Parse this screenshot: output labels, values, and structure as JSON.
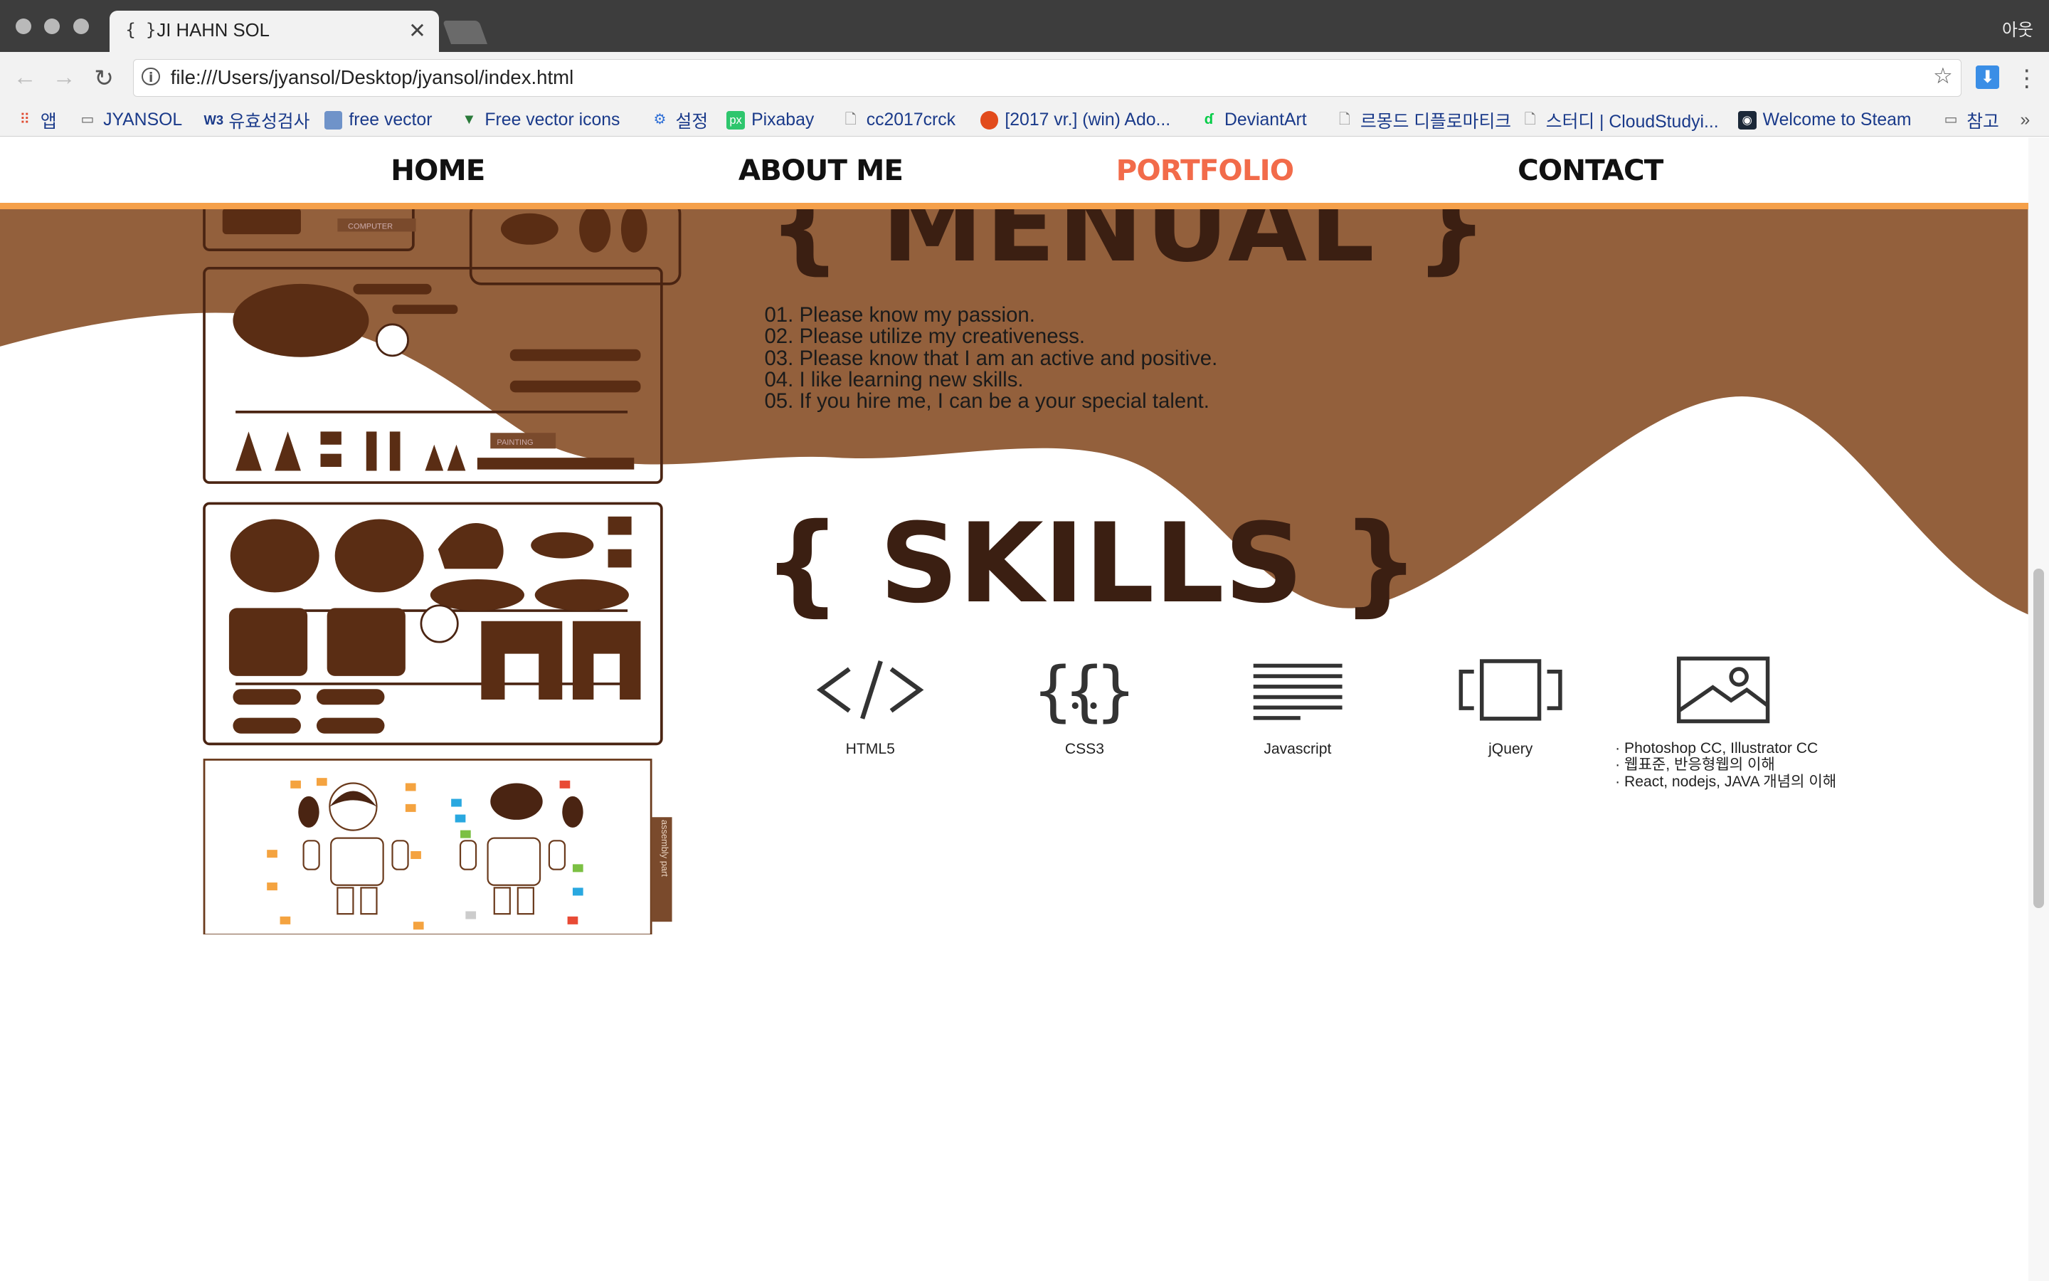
{
  "browser": {
    "tab_title": "JI HAHN SOL",
    "tab_icon_text": "{ }",
    "profile_label": "아웃",
    "url": "file:///Users/jyansol/Desktop/jyansol/index.html"
  },
  "bookmarks": [
    {
      "label": "앱",
      "icon": "apps-grid-icon"
    },
    {
      "label": "JYANSOL",
      "icon": "folder-icon"
    },
    {
      "label": "유효성검사",
      "icon": "w3c-icon"
    },
    {
      "label": "free vector",
      "icon": "image-icon"
    },
    {
      "label": "Free vector icons",
      "icon": "flaticon-icon"
    },
    {
      "label": "설정",
      "icon": "gear-icon"
    },
    {
      "label": "Pixabay",
      "icon": "pixabay-icon"
    },
    {
      "label": "cc2017crck",
      "icon": "page-icon"
    },
    {
      "label": "[2017 vr.] (win) Ado...",
      "icon": "red-circle-icon"
    },
    {
      "label": "DeviantArt",
      "icon": "deviantart-icon"
    },
    {
      "label": "르몽드 디플로마티크",
      "icon": "page-icon"
    },
    {
      "label": "스터디 | CloudStudyi...",
      "icon": "page-icon"
    },
    {
      "label": "Welcome to Steam",
      "icon": "steam-icon"
    },
    {
      "label": "참고",
      "icon": "folder-icon"
    }
  ],
  "bookmarks_overflow": "»",
  "nav": {
    "home": "HOME",
    "about": "ABOUT ME",
    "portfolio": "PORTFOLIO",
    "contact": "CONTACT",
    "active_color": "#f26b4a"
  },
  "menual": {
    "title": "{ MENUAL }",
    "items": [
      "01. Please know my passion.",
      "02. Please utilize my creativeness.",
      "03. Please know that I am an active and positive.",
      "04. I like learning new skills.",
      "05. If you hire me, I can be a your special talent."
    ]
  },
  "skills": {
    "title": "{ SKILLS }",
    "items": [
      {
        "label": "HTML5",
        "icon": "code-brackets-icon"
      },
      {
        "label": "CSS3",
        "icon": "curly-braces-icon"
      },
      {
        "label": "Javascript",
        "icon": "text-lines-icon"
      },
      {
        "label": "jQuery",
        "icon": "carousel-icon"
      },
      {
        "label": "",
        "icon": "image-frame-icon"
      }
    ],
    "extra": [
      "· Photoshop CC, Illustrator CC",
      "· 웹표준, 반응형웹의 이해",
      "· React, nodejs, JAVA 개념의 이해"
    ]
  },
  "parts_art": {
    "computer_tag": "COMPUTER",
    "painting_tag": "PAINTING",
    "side_tag": "assembly part"
  },
  "colors": {
    "brown_wave": "#93603c",
    "dark_brown": "#3b1f12",
    "nav_line": "#f5a04a"
  }
}
